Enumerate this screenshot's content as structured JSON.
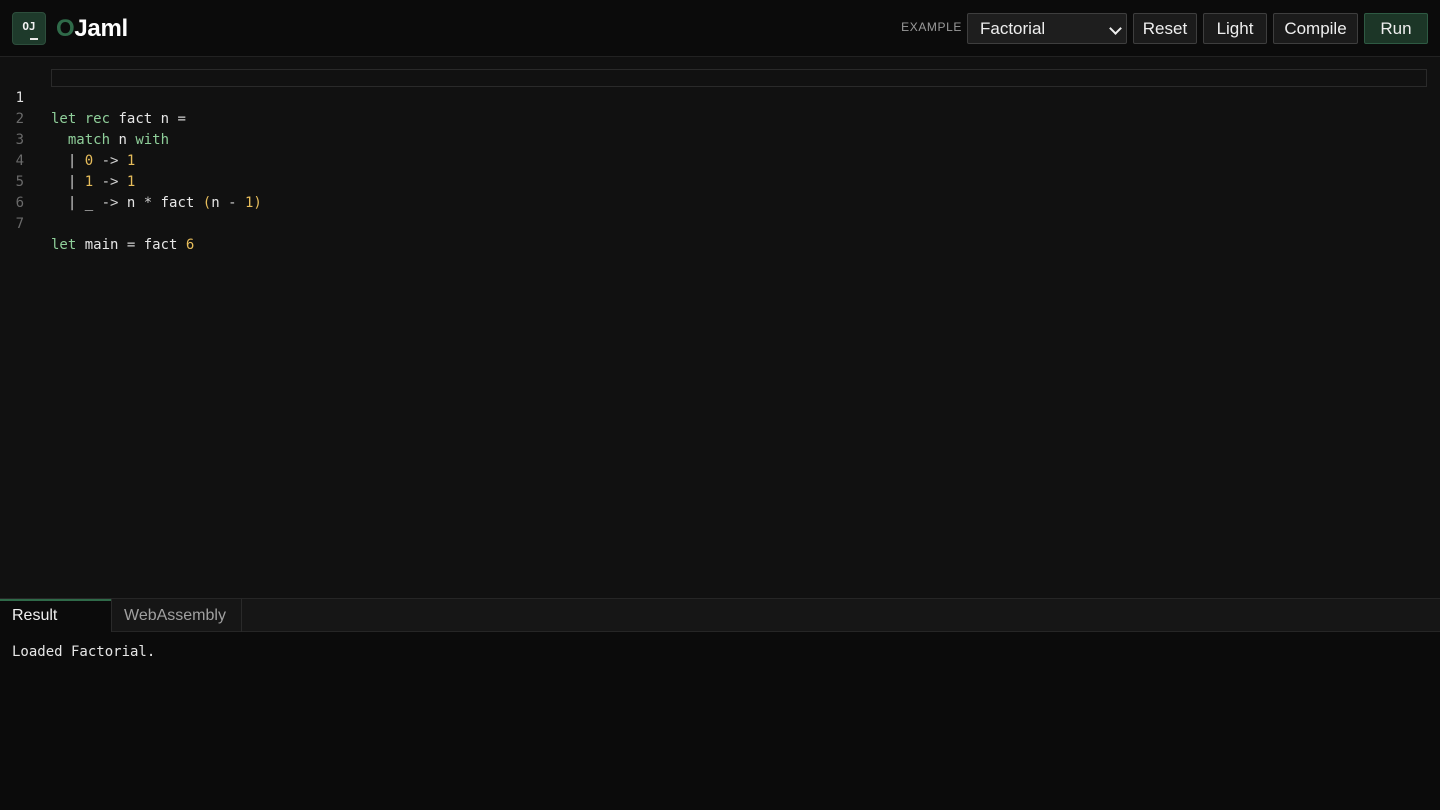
{
  "header": {
    "badge": "OJ",
    "logo_accent": "O",
    "logo_rest": "Jaml",
    "example_label": "EXAMPLE",
    "example_selected": "Factorial",
    "buttons": {
      "reset": "Reset",
      "light": "Light",
      "compile": "Compile",
      "run": "Run"
    }
  },
  "editor": {
    "line_numbers": [
      "1",
      "2",
      "3",
      "4",
      "5",
      "6",
      "7"
    ]
  },
  "panel": {
    "tabs": [
      "Result",
      "WebAssembly"
    ],
    "output": "Loaded Factorial."
  },
  "colors": {
    "accent": "#2f6a49",
    "keyword": "#8fcf9a",
    "number": "#e7bd5b",
    "background": "#111111"
  }
}
